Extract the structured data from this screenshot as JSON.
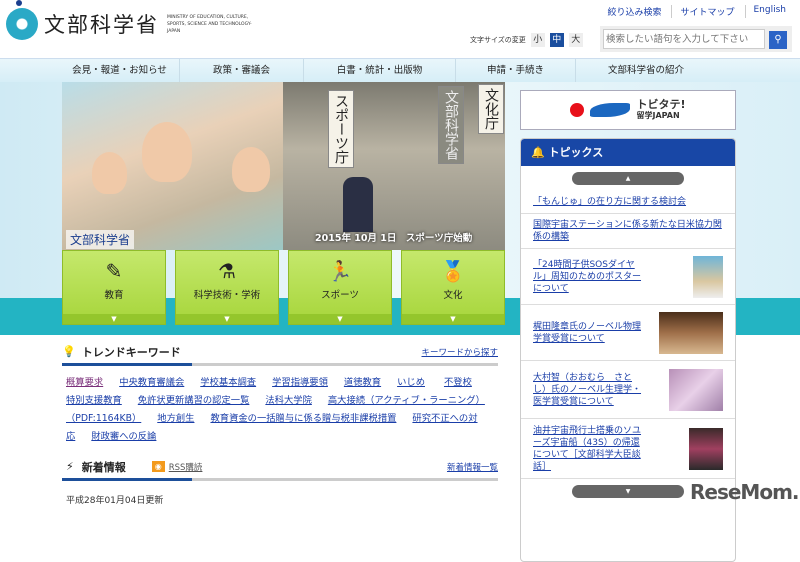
{
  "header": {
    "logo_text": "文部科学省",
    "logo_en": "MINISTRY OF EDUCATION, CULTURE, SPORTS, SCIENCE AND TECHNOLOGY-JAPAN",
    "top_links": [
      "絞り込み検索",
      "サイトマップ",
      "English"
    ],
    "font_size_label": "文字サイズの変更",
    "font_sizes": [
      "小",
      "中",
      "大"
    ],
    "search_placeholder": "検索したい語句を入力して下さい"
  },
  "nav": [
    "会見・報道・お知らせ",
    "政策・審議会",
    "白書・統計・出版物",
    "申請・手続き",
    "文部科学省の紹介"
  ],
  "hero": {
    "logo": "文部科学省",
    "caption": "2015年 10月 1日　スポーツ庁始動",
    "sign1": "スポーツ庁",
    "sign2": "文部科学省",
    "sign3": "文化庁"
  },
  "tiles": [
    {
      "label": "教育",
      "icon": "✎"
    },
    {
      "label": "科学技術・学術",
      "icon": "⚗"
    },
    {
      "label": "スポーツ",
      "icon": "🏃"
    },
    {
      "label": "文化",
      "icon": "🏅"
    }
  ],
  "trend": {
    "title": "トレンドキーワード",
    "more": "キーワードから探す",
    "keywords": [
      "概算要求",
      "中央教育審議会",
      "学校基本調査",
      "学習指導要領",
      "道徳教育",
      "いじめ",
      "不登校",
      "特別支援教育",
      "免許状更新講習の認定一覧",
      "法科大学院",
      "高大接続（アクティブ・ラーニング）（PDF:1164KB）",
      "地方創生",
      "教育資金の一括贈与に係る贈与税非課税措置",
      "研究不正への対応",
      "財政審への反論"
    ]
  },
  "news": {
    "title": "新着情報",
    "rss": "RSS購読",
    "more": "新着情報一覧",
    "updated": "平成28年01月04日更新"
  },
  "side": {
    "banner_title": "トビタテ!",
    "banner_sub": "留学JAPAN",
    "topics_title": "トピックス",
    "topics": [
      "「もんじゅ」の在り方に関する検討会",
      "国際宇宙ステーションに係る新たな日米協力関係の構築",
      "「24時間子供SOSダイヤル」周知のためのポスターについて",
      "梶田隆章氏のノーベル物理学賞受賞について",
      "大村智（おおむら　さとし）氏のノーベル生理学・医学賞受賞について",
      "油井宇宙飛行士搭乗のソユーズ宇宙船（43S）の帰還について［文部科学大臣談話］"
    ]
  },
  "watermark": "ReseMom."
}
